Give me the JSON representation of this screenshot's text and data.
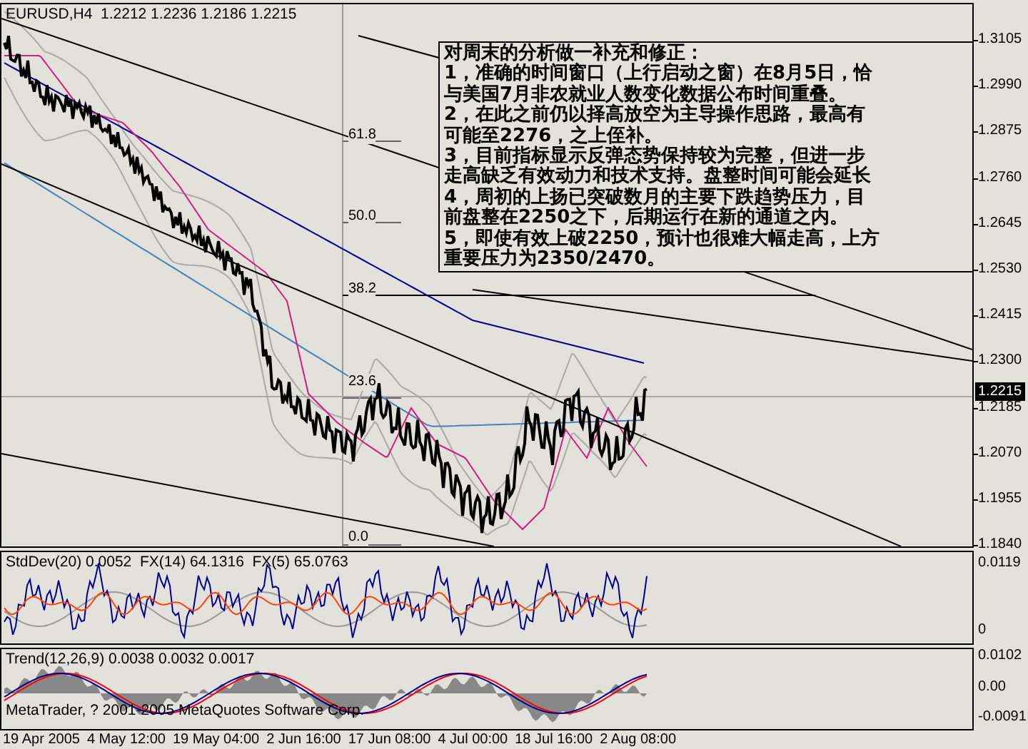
{
  "chart": {
    "symbol": "EURUSD,H4",
    "quotes": [
      "1.2212",
      "1.2236",
      "1.2186",
      "1.2215"
    ],
    "fibonacci_levels": [
      "61.8",
      "50.0",
      "38.2",
      "23.6",
      "0.0"
    ],
    "note_lines": [
      "对周末的分析做一补充和修正：",
      "1，准确的时间窗口（上行启动之窗）在8月5日，恰",
      "与美国7月非农就业人数变化数据公布时间重叠。",
      "2，在此之前仍以择高放空为主导操作思路，最高有",
      "可能至2276，之上侄补。",
      "3，目前指标显示反弹态势保持较为完整，但进一步",
      "走高缺乏有效动力和技术支持。盘整时间可能会延长",
      "4，周初的上扬已突破数月的主要下跌趋势压力，目",
      "前盘整在2250之下，后期运行在新的通道之内。",
      "5，即使有效上破2250，预计也很难大幅走高，上方",
      "重要压力为2350/2470。"
    ],
    "price_axis": [
      "1.3105",
      "1.2990",
      "1.2875",
      "1.2760",
      "1.2645",
      "1.2530",
      "1.2415",
      "1.2300",
      "1.2185",
      "1.2070",
      "1.1955",
      "1.1840"
    ],
    "current_price": "1.2215"
  },
  "indicator_1": {
    "title": "StdDev(20) 0.0052  FX(14) 64.1316  FX(5) 65.0763",
    "axis": [
      "0.0119",
      "0"
    ]
  },
  "indicator_2": {
    "title": "Trend(12,26,9) 0.0038 0.0032 0.0017",
    "copyright": "MetaTrader, ? 2001-2005 MetaQuotes Software Corp.",
    "axis": [
      "0.0102",
      "0.00",
      "-0.0091"
    ]
  },
  "time_axis": [
    "19 Apr 2005",
    "4 May 12:00",
    "19 May 04:00",
    "2 Jun 16:00",
    "17 Jun 08:00",
    "4 Jul 00:00",
    "18 Jul 16:00",
    "2 Aug 08:00"
  ]
}
